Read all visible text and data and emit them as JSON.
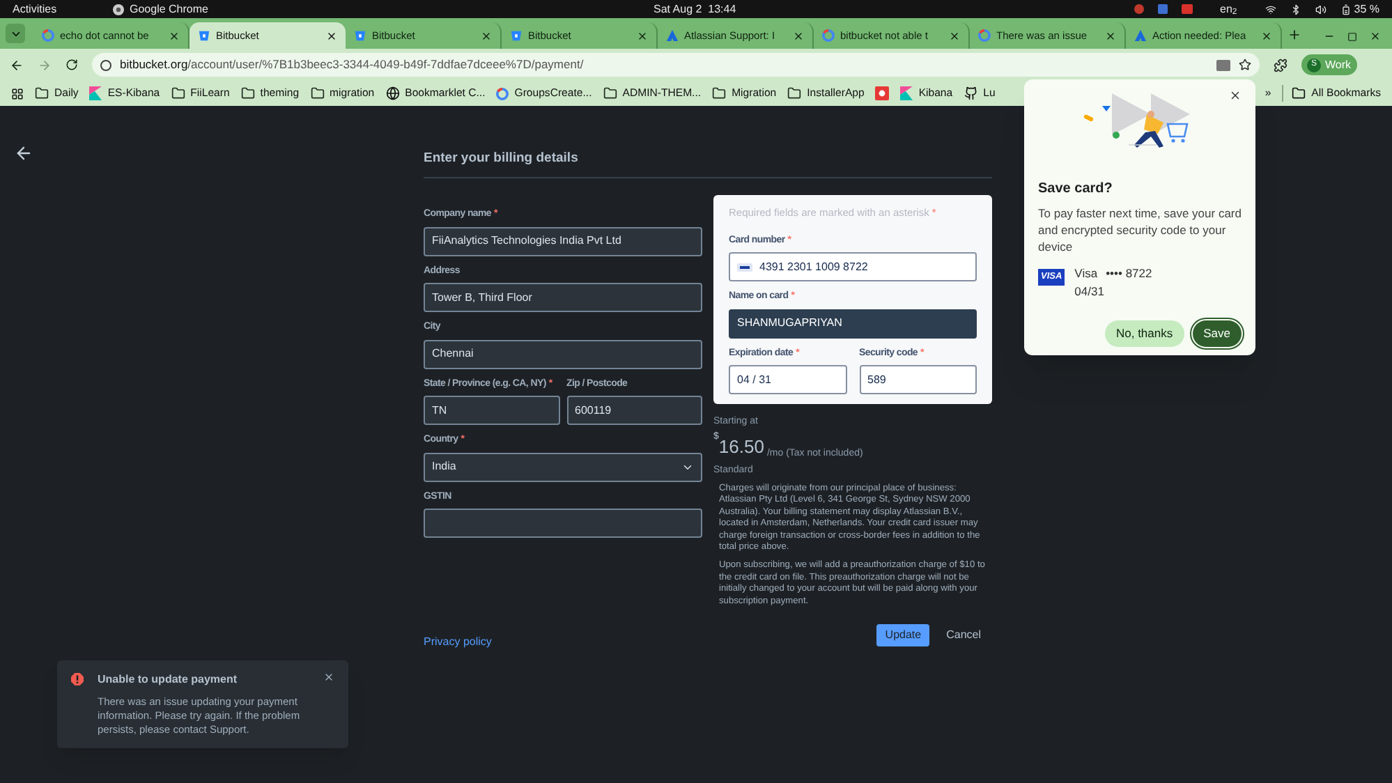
{
  "system_bar": {
    "activities": "Activities",
    "app": "Google Chrome",
    "clock": "Sat Aug 2  13:44",
    "keyboard": "en$_{2}$",
    "battery": "35 %"
  },
  "tabs": [
    {
      "title": "echo dot cannot be",
      "kind": "google",
      "selected": false
    },
    {
      "title": "Bitbucket",
      "kind": "bitbucket",
      "selected": true
    },
    {
      "title": "Bitbucket",
      "kind": "bitbucket",
      "selected": false
    },
    {
      "title": "Bitbucket",
      "kind": "bitbucket",
      "selected": false
    },
    {
      "title": "Atlassian Support: I",
      "kind": "atlassian",
      "selected": false
    },
    {
      "title": "bitbucket not able t",
      "kind": "google",
      "selected": false
    },
    {
      "title": "There was an issue",
      "kind": "google",
      "selected": false
    },
    {
      "title": "Action needed: Plea",
      "kind": "atlassian",
      "selected": false
    }
  ],
  "address_bar": {
    "host": "bitbucket.org",
    "path": "/account/user/%7B1b3beec3-3344-4049-b49f-7ddfae7dceee%7D/payment/",
    "avatar": "S",
    "profile": "Work"
  },
  "bookmarks": [
    {
      "label": "Daily",
      "kind": "folder"
    },
    {
      "label": "ES-Kibana",
      "kind": "kibana"
    },
    {
      "label": "FiiLearn",
      "kind": "folder"
    },
    {
      "label": "theming",
      "kind": "folder"
    },
    {
      "label": "migration",
      "kind": "folder"
    },
    {
      "label": "Bookmarklet C...",
      "kind": "globe"
    },
    {
      "label": "GroupsCreate...",
      "kind": "google"
    },
    {
      "label": "ADMIN-THEM...",
      "kind": "folder"
    },
    {
      "label": "Migration",
      "kind": "folder"
    },
    {
      "label": "InstallerApp",
      "kind": "folder"
    },
    {
      "kind": "app"
    },
    {
      "label": "Kibana",
      "kind": "kibana"
    },
    {
      "label": "Lu",
      "kind": "github"
    }
  ],
  "required_mark": "*",
  "bookmarks_more": "»",
  "all_bookmarks": "All Bookmarks",
  "form": {
    "title": "Enter your billing details",
    "rows": [
      [
        {
          "label": "Company name",
          "required": true,
          "kind": "text",
          "value": "FiiAnalytics Technologies India Pvt Ltd"
        }
      ],
      [
        {
          "label": "Address",
          "required": false,
          "kind": "text",
          "value": "Tower B, Third Floor"
        }
      ],
      [
        {
          "label": "City",
          "required": false,
          "kind": "text",
          "value": "Chennai"
        }
      ],
      [
        {
          "label": "State / Province (e.g. CA, NY)",
          "required": true,
          "kind": "text",
          "value": "TN"
        },
        {
          "label": "Zip / Postcode",
          "required": false,
          "kind": "text",
          "value": "600119"
        }
      ],
      [
        {
          "label": "Country",
          "required": true,
          "kind": "select",
          "value": "India"
        }
      ],
      [
        {
          "label": "GSTIN",
          "required": false,
          "kind": "text"
        }
      ]
    ],
    "privacy_link": "Privacy policy"
  },
  "card": {
    "note": "Required fields are marked with an asterisk",
    "rows": [
      [
        {
          "label": "Card number",
          "required": true,
          "kind": "card",
          "value": "4391 2301 1009 8722",
          "highlighted": false
        }
      ],
      [
        {
          "label": "Name on card",
          "required": true,
          "kind": "text",
          "value": "SHANMUGAPRIYAN",
          "highlighted": true
        }
      ],
      [
        {
          "label": "Expiration date",
          "required": true,
          "kind": "text",
          "value": "04 / 31",
          "highlighted": false
        },
        {
          "label": "Security code",
          "required": true,
          "kind": "text",
          "value": "589",
          "highlighted": false
        }
      ]
    ]
  },
  "price": {
    "starting": "Starting at",
    "currency": "$",
    "amount": "16.50",
    "period": "/mo (Tax not included)",
    "plan": "Standard",
    "notes": [
      "Charges will originate from our principal place of business: Atlassian Pty Ltd (Level 6, 341 George St, Sydney NSW 2000 Australia). Your billing statement may display Atlassian B.V., located in Amsterdam, Netherlands. Your credit card issuer may charge foreign transaction or cross-border fees in addition to the total price above.",
      "Upon subscribing, we will add a preauthorization charge of $10 to the credit card on file. This preauthorization charge will not be initially changed to your account but will be paid along with your subscription payment."
    ]
  },
  "actions": {
    "primary": "Update",
    "secondary": "Cancel"
  },
  "toast": {
    "title": "Unable to update payment",
    "message": "There was an issue updating your payment information. Please try again. If the problem persists, please contact Support."
  },
  "save_card_popup": {
    "title": "Save card?",
    "message": "To pay faster next time, save your card and encrypted security code to your device",
    "brand": "VISA",
    "card_name": "Visa",
    "card_number": "•••• 8722",
    "expiry": "04/31",
    "decline": "No, thanks",
    "accept": "Save"
  }
}
